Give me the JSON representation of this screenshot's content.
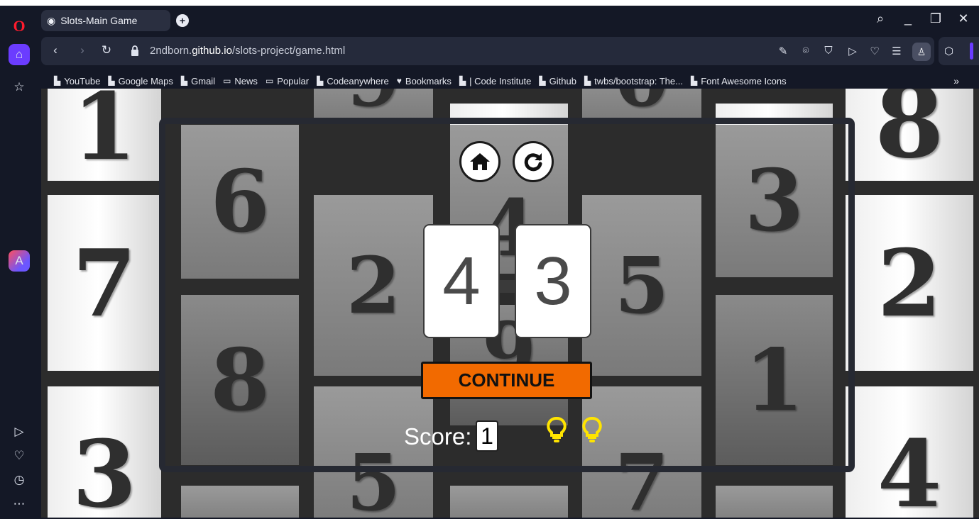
{
  "browser": {
    "tab_title": "Slots-Main Game",
    "url_prefix": "2ndborn.",
    "url_domain": "github.io",
    "url_path": "/slots-project/game.html",
    "bookmarks": [
      {
        "label": "YouTube",
        "icon": "page-icon"
      },
      {
        "label": "Google Maps",
        "icon": "page-icon"
      },
      {
        "label": "Gmail",
        "icon": "page-icon"
      },
      {
        "label": "News",
        "icon": "folder-icon"
      },
      {
        "label": "Popular",
        "icon": "folder-icon"
      },
      {
        "label": "Codeanywhere",
        "icon": "page-icon"
      },
      {
        "label": "Bookmarks",
        "icon": "heart-icon"
      },
      {
        "label": "| Code Institute",
        "icon": "page-icon"
      },
      {
        "label": "Github",
        "icon": "page-icon"
      },
      {
        "label": "twbs/bootstrap: The...",
        "icon": "page-icon"
      },
      {
        "label": "Font Awesome Icons",
        "icon": "page-icon"
      }
    ],
    "accent_color": "#6b3cff"
  },
  "game": {
    "background_tiles": [
      "1",
      "9",
      "0",
      "8",
      "6",
      "4",
      "3",
      "7",
      "2",
      "5",
      "2",
      "8",
      "9",
      "1",
      "3",
      "5",
      "7",
      "4"
    ],
    "cards": [
      "4",
      "3"
    ],
    "continue_label": "CONTINUE",
    "score_label": "Score:",
    "score_value": "1",
    "hints_remaining": 2,
    "button_color": "#f26a00",
    "hint_color": "#ffe400"
  }
}
